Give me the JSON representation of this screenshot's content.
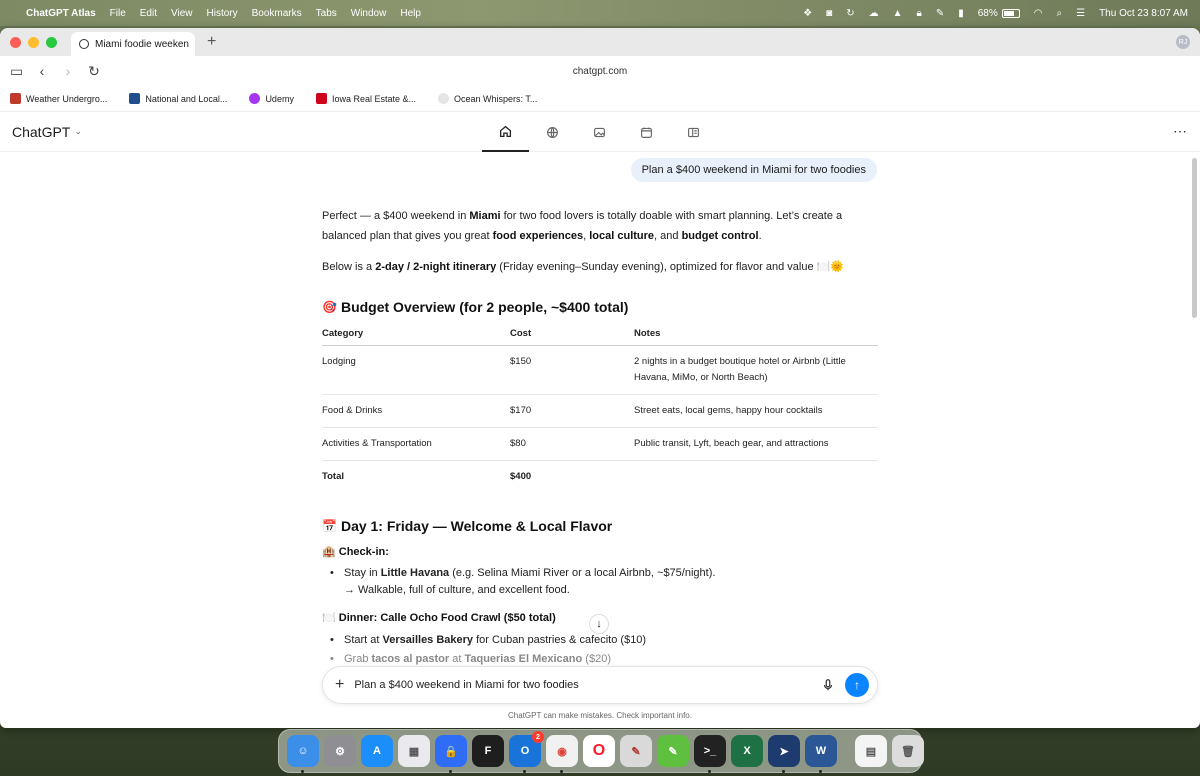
{
  "menubar": {
    "app": "ChatGPT Atlas",
    "menus": [
      "File",
      "Edit",
      "View",
      "History",
      "Bookmarks",
      "Tabs",
      "Window",
      "Help"
    ],
    "battery": "68%",
    "datetime": "Thu Oct 23  8:07 AM"
  },
  "browser": {
    "tab_title": "Miami foodie weeken",
    "url": "chatgpt.com",
    "profile_initials": "RJ",
    "bookmarks": [
      {
        "label": "Weather Undergro...",
        "color": "#c0392b"
      },
      {
        "label": "National and Local...",
        "color": "#1f4e8c"
      },
      {
        "label": "Udemy",
        "color": "#a435f0"
      },
      {
        "label": "Iowa Real Estate &...",
        "color": "#d0021b"
      },
      {
        "label": "Ocean Whispers: T...",
        "color": "#cfcfcf"
      }
    ]
  },
  "app": {
    "brand": "ChatGPT",
    "toolbar_icons": [
      "home-icon",
      "globe-icon",
      "image-icon",
      "calendar-icon",
      "layout-icon"
    ]
  },
  "conversation": {
    "user_message": "Plan a $400 weekend in Miami for two foodies",
    "intro_p1": {
      "a": "Perfect — a $400 weekend in ",
      "b": "Miami",
      "c": " for two food lovers is totally doable with smart planning. Let’s create a balanced plan that gives you great ",
      "d": "food experiences",
      "e": ", ",
      "f": "local culture",
      "g": ", and ",
      "h": "budget control",
      "i": "."
    },
    "intro_p2": {
      "a": "Below is a ",
      "b": "2-day / 2-night itinerary",
      "c": " (Friday evening–Sunday evening), optimized for flavor and value 🍽️🌞"
    },
    "budget_heading": "Budget Overview (for 2 people, ~$400 total)",
    "budget_emoji": "🎯",
    "table": {
      "headers": [
        "Category",
        "Cost",
        "Notes"
      ],
      "rows": [
        [
          "Lodging",
          "$150",
          "2 nights in a budget boutique hotel or Airbnb (Little Havana, MiMo, or North Beach)"
        ],
        [
          "Food & Drinks",
          "$170",
          "Street eats, local gems, happy hour cocktails"
        ],
        [
          "Activities & Transportation",
          "$80",
          "Public transit, Lyft, beach gear, and attractions"
        ],
        [
          "Total",
          "$400",
          ""
        ]
      ]
    },
    "day1_heading": "Day 1: Friday — Welcome & Local Flavor",
    "day1_emoji": "📅",
    "checkin_label": "Check-in:",
    "checkin_emoji": "🏨",
    "checkin_item": {
      "a": "Stay in ",
      "b": "Little Havana",
      "c": " (e.g. Selina Miami River or a local Airbnb, ~$75/night)."
    },
    "checkin_note": "→ Walkable, full of culture, and excellent food.",
    "dinner_label": "Dinner: Calle Ocho Food Crawl ($50 total)",
    "dinner_emoji": "🍽️",
    "dinner_item1": {
      "a": "Start at ",
      "b": "Versailles Bakery",
      "c": " for Cuban pastries & cafecito ($10)"
    },
    "dinner_item2": {
      "a": "Grab ",
      "b": "tacos al pastor",
      "c": " at ",
      "d": "Taquerias El Mexicano",
      "e": " ($20)"
    }
  },
  "composer": {
    "text": "Plan a $400 weekend in Miami for two foodies",
    "disclaimer": "ChatGPT can make mistakes. Check important info."
  },
  "dock": {
    "apps": [
      {
        "name": "finder",
        "color": "#3b8fe8",
        "glyph": "☺"
      },
      {
        "name": "system-settings",
        "color": "#8e8e93",
        "glyph": "⚙"
      },
      {
        "name": "app-store",
        "color": "#1c8ef9",
        "glyph": "A"
      },
      {
        "name": "launchpad",
        "color": "#e9e9ee",
        "glyph": "▦"
      },
      {
        "name": "passwords",
        "color": "#2f6df6",
        "glyph": "🔒"
      },
      {
        "name": "figma",
        "color": "#1e1e1e",
        "glyph": "F"
      },
      {
        "name": "outlook",
        "color": "#1a73d8",
        "glyph": "O",
        "badge": "2"
      },
      {
        "name": "chrome",
        "color": "#f1f1f1",
        "glyph": "◉"
      },
      {
        "name": "opera",
        "color": "#ff1b2d",
        "glyph": "O"
      },
      {
        "name": "pen-app",
        "color": "#d9d9d9",
        "glyph": "✎"
      },
      {
        "name": "notes-app",
        "color": "#5fbf3f",
        "glyph": "✎"
      },
      {
        "name": "terminal",
        "color": "#222222",
        "glyph": ">_"
      },
      {
        "name": "excel",
        "color": "#1e7145",
        "glyph": "X"
      },
      {
        "name": "telegram",
        "color": "#1e3b70",
        "glyph": "➤"
      },
      {
        "name": "word",
        "color": "#2b5797",
        "glyph": "W"
      },
      {
        "name": "document",
        "color": "#f4f4f4",
        "glyph": "▤"
      },
      {
        "name": "trash",
        "color": "#dcdcdc",
        "glyph": "🗑"
      }
    ]
  }
}
